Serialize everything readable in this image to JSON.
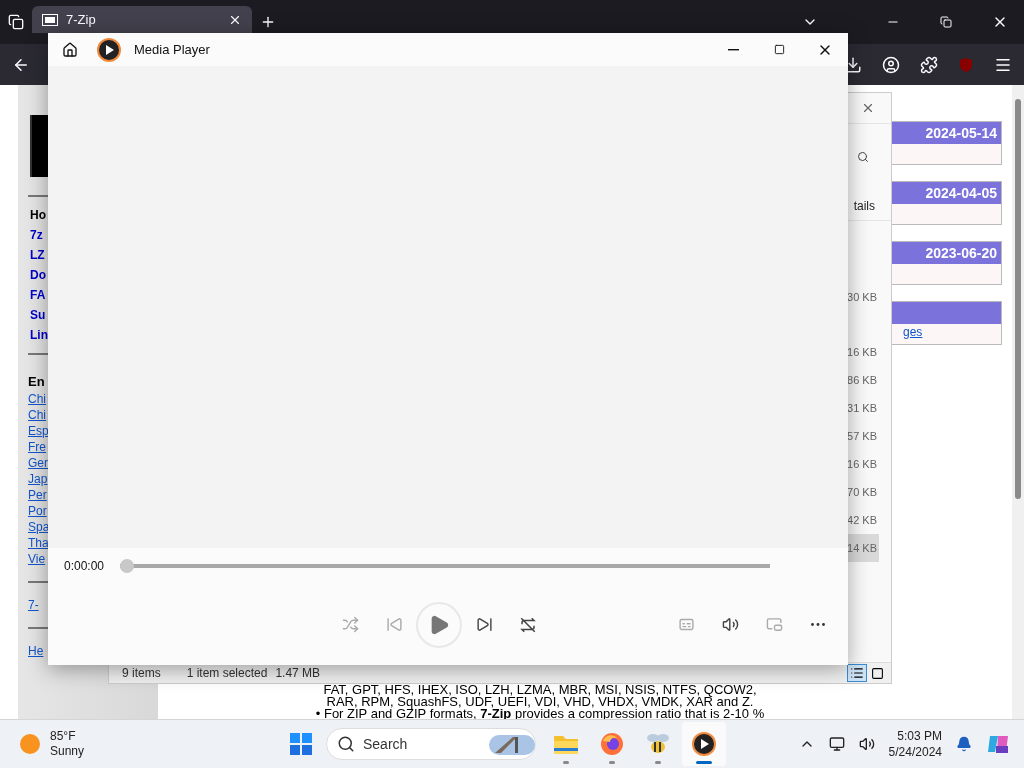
{
  "browser": {
    "tabs": [
      {
        "label": "7-Zip",
        "selected": true
      }
    ]
  },
  "webpage": {
    "nav_links": [
      {
        "text": "Ho",
        "kind": "current"
      },
      {
        "text": "7z",
        "kind": "link"
      },
      {
        "text": "LZ",
        "kind": "link"
      },
      {
        "text": "Do",
        "kind": "link"
      },
      {
        "text": "FA",
        "kind": "link"
      },
      {
        "text": "Su",
        "kind": "link"
      },
      {
        "text": "Lin",
        "kind": "link"
      }
    ],
    "languages_heading": "En",
    "language_links": [
      "Chi",
      "Chi",
      "Esp",
      "Fre",
      "Ger",
      "Jap",
      "Per",
      "Por",
      "Spa",
      "Tha",
      "Vie"
    ],
    "footer_links": [
      "7-",
      "He"
    ],
    "dates": [
      "2024-05-14",
      "2024-04-05",
      "2023-06-20"
    ],
    "link_fragment": "ges",
    "body_lines": [
      "FAT, GPT, HFS, IHEX, ISO, LZH, LZMA, MBR, MSI, NSIS, NTFS, QCOW2,",
      "RAR, RPM, SquashFS, UDF, UEFI, VDI, VHD, VHDX, VMDK, XAR and Z.",
      "• For ZIP and GZIP formats, **7-Zip** provides a compression ratio that is 2-10 %"
    ]
  },
  "explorer": {
    "partial_label": "tails",
    "sizes": [
      {
        "text": "30 KB",
        "selected": false
      },
      {
        "text": "16 KB",
        "selected": false
      },
      {
        "text": "86 KB",
        "selected": false
      },
      {
        "text": "31 KB",
        "selected": false
      },
      {
        "text": "57 KB",
        "selected": false
      },
      {
        "text": "16 KB",
        "selected": false
      },
      {
        "text": "70 KB",
        "selected": false
      },
      {
        "text": "42 KB",
        "selected": false
      },
      {
        "text": "14 KB",
        "selected": true
      }
    ],
    "status": {
      "count": "9 items",
      "selection": "1 item selected",
      "size": "1.47 MB"
    },
    "views": [
      {
        "kind": "details",
        "selected": true
      },
      {
        "kind": "tiles",
        "selected": false
      }
    ]
  },
  "media_player": {
    "title": "Media Player",
    "time": "0:00:00",
    "seek": {
      "level": 0
    }
  },
  "taskbar": {
    "weather": {
      "temp": "85°F",
      "condition": "Sunny"
    },
    "search_placeholder": "Search",
    "apps": [
      {
        "kind": "files",
        "active": false
      },
      {
        "kind": "firefox",
        "active": false
      },
      {
        "kind": "bee",
        "active": false
      },
      {
        "kind": "player",
        "active": true
      }
    ],
    "time": "5:03 PM",
    "date": "5/24/2024"
  }
}
